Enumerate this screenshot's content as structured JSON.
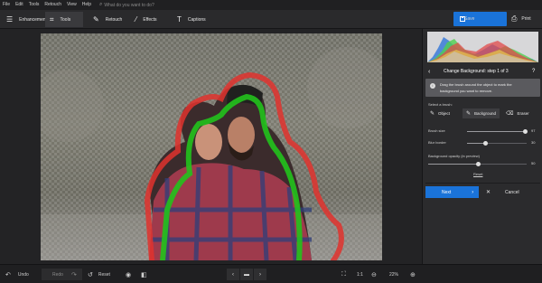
{
  "menu": {
    "items": [
      "File",
      "Edit",
      "Tools",
      "Retouch",
      "View",
      "Help"
    ],
    "search_placeholder": "What do you want to do?",
    "search_icon": "search-icon"
  },
  "toolbar": {
    "tabs": [
      {
        "label": "Enhancement",
        "icon": "sliders-icon"
      },
      {
        "label": "Tools",
        "icon": "crop-icon"
      },
      {
        "label": "Retouch",
        "icon": "brush-icon"
      },
      {
        "label": "Effects",
        "icon": "magic-wand-icon"
      },
      {
        "label": "Captions",
        "icon": "text-icon"
      }
    ],
    "active_tab": "Tools",
    "save_label": "Save",
    "print_label": "Print",
    "accent": "#1a73d9"
  },
  "canvas": {
    "brush_outline_colors": {
      "background": "#e0322e",
      "object": "#22c21c"
    }
  },
  "bottom": {
    "undo_label": "Undo",
    "redo_label": "Redo",
    "reset_label": "Reset",
    "zoom_ratio": "1:1",
    "zoom_percent": "22%"
  },
  "panel": {
    "title": "Change Background: step 1 of 3",
    "help": "?",
    "info_line1": "Drag the brush around the object to mark the",
    "info_line2": "background you want to remove.",
    "select_brush_label": "Select a brush:",
    "brushes": [
      {
        "label": "Object",
        "icon": "brush-icon",
        "active": false
      },
      {
        "label": "Background",
        "icon": "brush-icon",
        "active": true
      },
      {
        "label": "Eraser",
        "icon": "eraser-icon",
        "active": false
      }
    ],
    "brush_size_label": "Brush size",
    "brush_size_value": "97",
    "brush_size_fraction": 0.97,
    "blur_border_label": "Blur border",
    "blur_border_value": "30",
    "blur_border_fraction": 0.3,
    "bg_opacity_label": "Background opacity (in preview)",
    "bg_opacity_value": "50",
    "bg_opacity_fraction": 0.5,
    "reset_label": "Reset",
    "next_label": "Next",
    "cancel_label": "Cancel"
  }
}
